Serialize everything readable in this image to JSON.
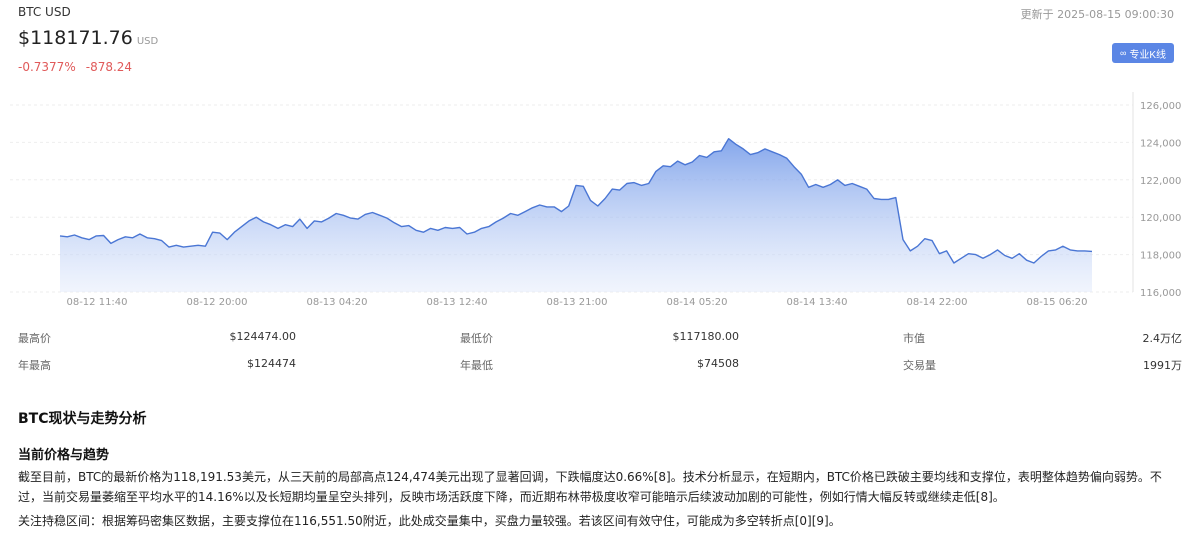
{
  "header": {
    "symbol": "BTC USD",
    "updated": "更新于 2025-08-15 09:00:30",
    "price": "$118171.76",
    "currency": "USD",
    "change_pct": "-0.7377%",
    "change_abs": "-878.24",
    "kline_button": "专业K线"
  },
  "colors": {
    "down": "#e05a5a",
    "line": "#4a76d4",
    "button": "#5b86e5"
  },
  "chart_data": {
    "type": "area",
    "ylim": [
      116000,
      126000
    ],
    "yticks": [
      "116,000",
      "118,000",
      "120,000",
      "122,000",
      "124,000",
      "126,000"
    ],
    "ytick_values": [
      116000,
      118000,
      120000,
      122000,
      124000,
      126000
    ],
    "xticks": [
      "08-12 11:40",
      "08-12 20:00",
      "08-13 04:20",
      "08-13 12:40",
      "08-13 21:00",
      "08-14 05:20",
      "08-14 13:40",
      "08-14 22:00",
      "08-15 06:20"
    ],
    "x_step_hours": 1,
    "values": [
      119000,
      118950,
      119050,
      118900,
      118800,
      119000,
      119020,
      118600,
      118800,
      118950,
      118900,
      119100,
      118900,
      118850,
      118750,
      118400,
      118500,
      118400,
      118450,
      118500,
      118450,
      119200,
      119150,
      118800,
      119200,
      119500,
      119800,
      120000,
      119750,
      119600,
      119400,
      119600,
      119500,
      119900,
      119400,
      119800,
      119750,
      119950,
      120200,
      120100,
      119950,
      119900,
      120150,
      120250,
      120100,
      119950,
      119700,
      119500,
      119550,
      119300,
      119200,
      119400,
      119300,
      119450,
      119400,
      119450,
      119100,
      119200,
      119400,
      119500,
      119750,
      119950,
      120200,
      120100,
      120300,
      120500,
      120650,
      120550,
      120550,
      120300,
      120600,
      121700,
      121650,
      120900,
      120600,
      121000,
      121500,
      121450,
      121800,
      121850,
      121700,
      121800,
      122450,
      122750,
      122700,
      123000,
      122800,
      122950,
      123300,
      123200,
      123500,
      123550,
      124200,
      123900,
      123650,
      123350,
      123450,
      123650,
      123500,
      123350,
      123150,
      122700,
      122300,
      121600,
      121750,
      121600,
      121750,
      122000,
      121700,
      121800,
      121650,
      121500,
      121000,
      120950,
      120950,
      121050,
      118800,
      118200,
      118450,
      118850,
      118750,
      118050,
      118200,
      117550,
      117800,
      118050,
      118000,
      117800,
      118000,
      118250,
      117950,
      117800,
      118050,
      117700,
      117550,
      117900,
      118200,
      118250,
      118450,
      118250,
      118200,
      118200,
      118171
    ]
  },
  "stats": [
    [
      {
        "label": "最高价",
        "value": "$124474.00"
      },
      {
        "label": "最低价",
        "value": "$117180.00"
      },
      {
        "label": "市值",
        "value": "2.4万亿"
      }
    ],
    [
      {
        "label": "年最高",
        "value": "$124474"
      },
      {
        "label": "年最低",
        "value": "$74508"
      },
      {
        "label": "交易量",
        "value": "1991万"
      }
    ]
  ],
  "analysis": {
    "title": "BTC现状与走势分析",
    "subtitle": "当前价格与趋势",
    "p1": "截至目前，BTC的最新价格为118,191.53美元，从三天前的局部高点124,474美元出现了显著回调，下跌幅度达0.66%[8]。技术分析显示，在短期内，BTC价格已跌破主要均线和支撑位，表明整体趋势偏向弱势。不过，当前交易量萎缩至平均水平的14.16%以及长短期均量呈空头排列，反映市场活跃度下降，而近期布林带极度收窄可能暗示后续波动加剧的可能性，例如行情大幅反转或继续走低[8]。",
    "p2": "关注持稳区间：根据筹码密集区数据，主要支撑位在116,551.50附近，此处成交量集中，买盘力量较强。若该区间有效守住，可能成为多空转折点[0][9]。"
  }
}
